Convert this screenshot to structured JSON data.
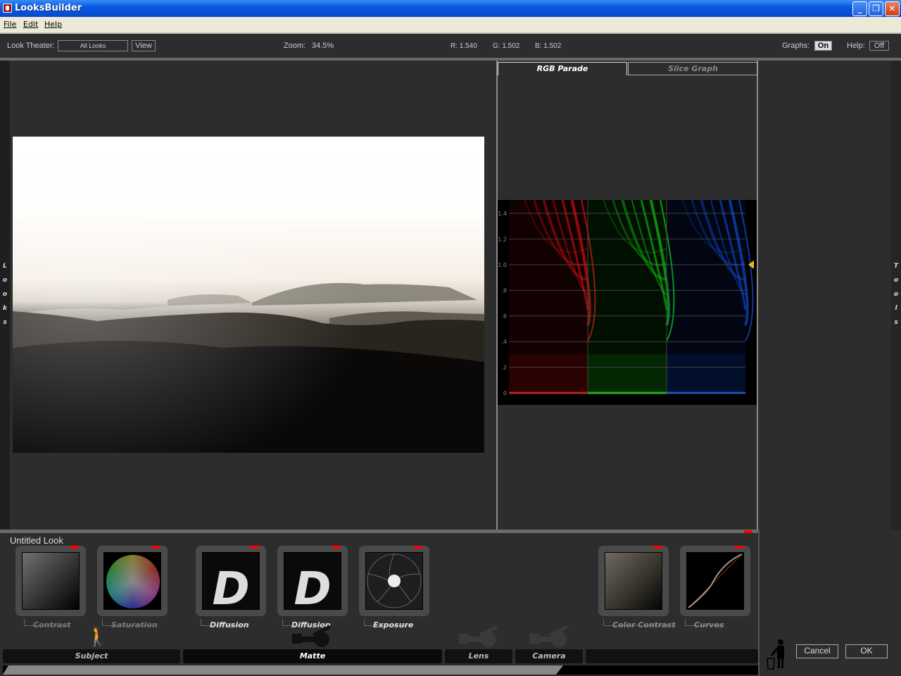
{
  "window": {
    "title": "LooksBuilder",
    "buttons": {
      "minimize": "_",
      "restore": "❐",
      "close": "✕"
    }
  },
  "menu": [
    "File",
    "Edit",
    "Help"
  ],
  "toolbar": {
    "look_theater_label": "Look Theater:",
    "look_theater_value": "All Looks",
    "view_label": "View",
    "zoom_label": "Zoom:",
    "zoom_value": "34.5%",
    "r": "R: 1.540",
    "g": "G: 1.502",
    "b": "B: 1.502",
    "graphs_label": "Graphs:",
    "graphs_value": "On",
    "help_label": "Help:",
    "help_value": "Off"
  },
  "side_tabs": {
    "left": [
      "L",
      "o",
      "o",
      "k",
      "s"
    ],
    "right": [
      "T",
      "o",
      "o",
      "l",
      "s"
    ]
  },
  "graph_tabs": [
    "RGB Parade",
    "Slice Graph"
  ],
  "parade": {
    "y_labels": [
      "1.4",
      "1.2",
      "1.0",
      ".8",
      ".6",
      ".4",
      ".2",
      "0"
    ],
    "colors": {
      "red": "#e01010",
      "green": "#10d010",
      "blue": "#1050e0",
      "marker": "#f0c000"
    }
  },
  "look": {
    "title": "Untitled Look",
    "tools": [
      {
        "label": "Contrast",
        "active": false
      },
      {
        "label": "Saturation",
        "active": false
      },
      {
        "label": "Diffusion",
        "active": true
      },
      {
        "label": "Diffusion",
        "active": true
      },
      {
        "label": "Exposure",
        "active": true
      },
      {
        "label": "Color Contrast",
        "active": false
      },
      {
        "label": "Curves",
        "active": false
      }
    ]
  },
  "categories": [
    "Subject",
    "Matte",
    "Lens",
    "Camera"
  ],
  "actions": {
    "cancel": "Cancel",
    "ok": "OK"
  }
}
